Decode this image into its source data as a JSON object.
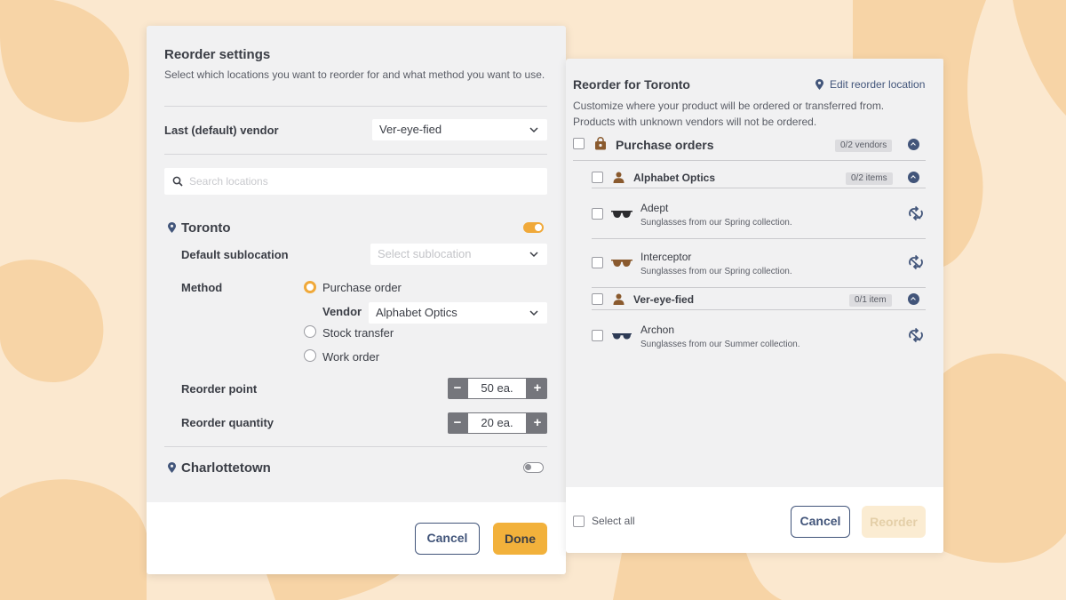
{
  "settings": {
    "title": "Reorder settings",
    "description": "Select which locations you want to reorder for and what method you want to use.",
    "default_vendor_label": "Last (default) vendor",
    "default_vendor_value": "Ver-eye-fied",
    "search_placeholder": "Search locations",
    "locations": [
      {
        "name": "Toronto",
        "enabled": true,
        "sublocation_label": "Default sublocation",
        "sublocation_placeholder": "Select sublocation",
        "method_label": "Method",
        "methods": [
          "Purchase order",
          "Stock transfer",
          "Work order"
        ],
        "selected_method": "Purchase order",
        "vendor_label": "Vendor",
        "vendor_value": "Alphabet Optics",
        "reorder_point_label": "Reorder point",
        "reorder_point_value": "50 ea.",
        "reorder_quantity_label": "Reorder quantity",
        "reorder_quantity_value": "20 ea."
      },
      {
        "name": "Charlottetown",
        "enabled": false
      }
    ],
    "stepper_minus": "−",
    "stepper_plus": "+",
    "cancel_label": "Cancel",
    "done_label": "Done"
  },
  "reorder": {
    "title": "Reorder for Toronto",
    "edit_link": "Edit reorder location",
    "description": "Customize where your product will be ordered or transferred from. Products with unknown vendors will not be ordered.",
    "group_title": "Purchase orders",
    "group_count": "0/2 vendors",
    "vendors": [
      {
        "name": "Alphabet Optics",
        "count": "0/2 items",
        "items": [
          {
            "name": "Adept",
            "desc": "Sunglasses from our Spring collection."
          },
          {
            "name": "Interceptor",
            "desc": "Sunglasses from our Spring collection."
          }
        ]
      },
      {
        "name": "Ver-eye-fied",
        "count": "0/1 item",
        "items": [
          {
            "name": "Archon",
            "desc": "Sunglasses from our Summer collection."
          }
        ]
      }
    ],
    "select_all_label": "Select all",
    "cancel_label": "Cancel",
    "reorder_label": "Reorder"
  },
  "colors": {
    "accent": "#f2b13b",
    "navy": "#42557a",
    "background": "#fbe8cf"
  }
}
